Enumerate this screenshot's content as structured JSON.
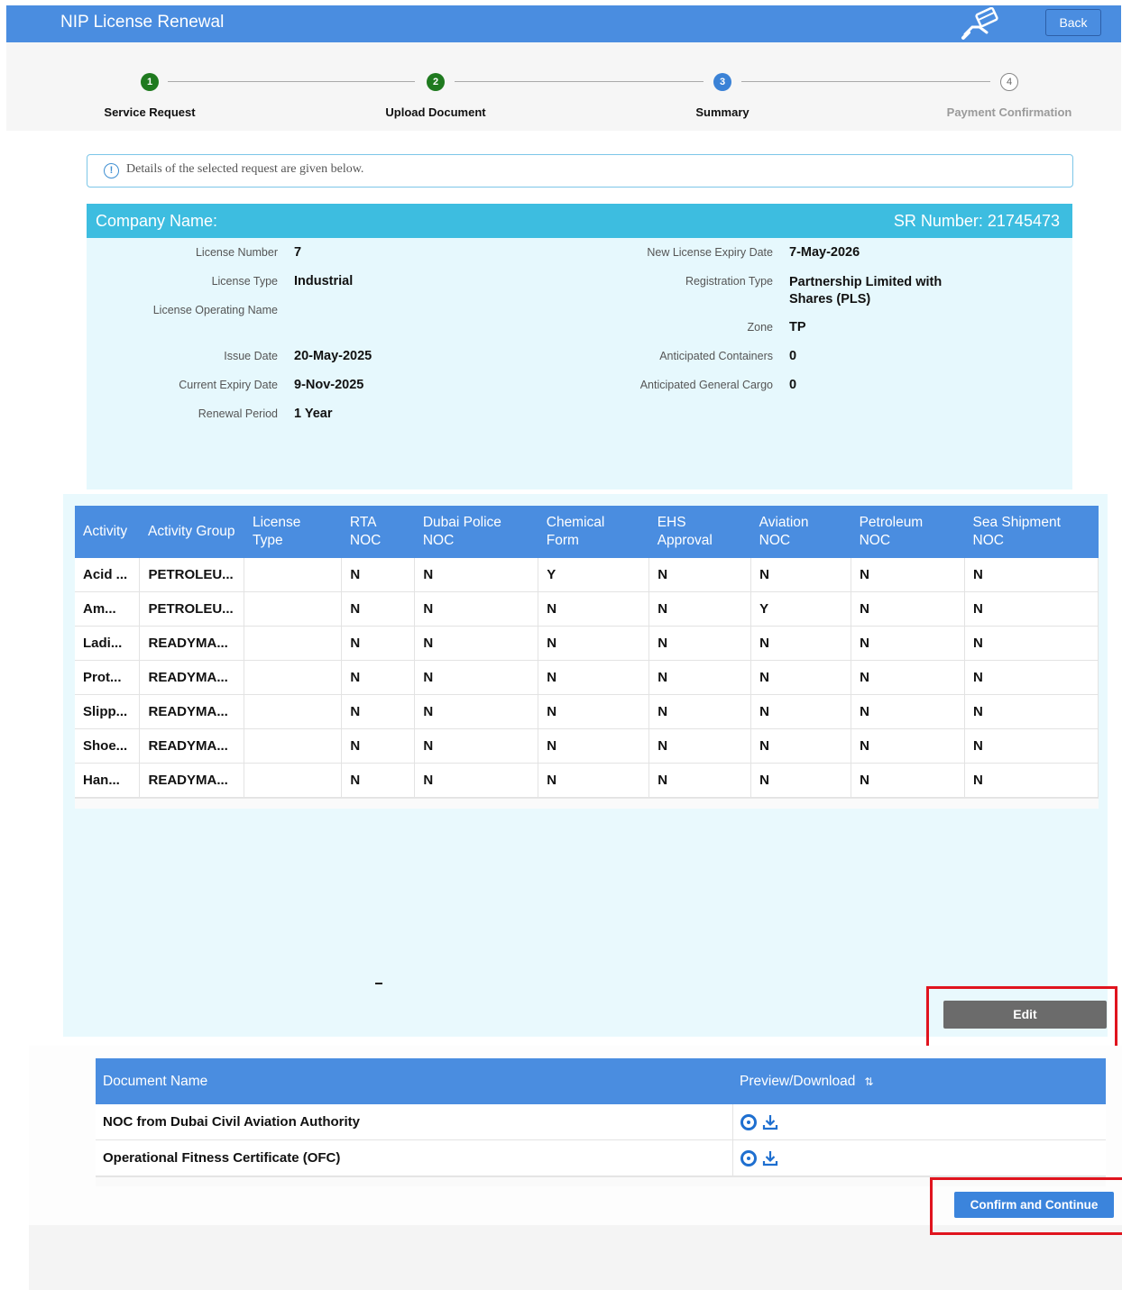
{
  "header": {
    "title": "NIP License Renewal",
    "back_label": "Back",
    "icon": "hand-card-payment-icon"
  },
  "stepper": {
    "steps": [
      {
        "number": "1",
        "label": "Service Request",
        "state": "done"
      },
      {
        "number": "2",
        "label": "Upload Document",
        "state": "done"
      },
      {
        "number": "3",
        "label": "Summary",
        "state": "current"
      },
      {
        "number": "4",
        "label": "Payment Confirmation",
        "state": "todo"
      }
    ]
  },
  "info_banner": {
    "text": "Details of the selected request are given below."
  },
  "company": {
    "name_label": "Company Name:",
    "sr_label": "SR Number: 21745473",
    "left_fields": [
      {
        "label": "License Number",
        "value": "7"
      },
      {
        "label": "License Type",
        "value": "Industrial"
      },
      {
        "label": "License Operating Name",
        "value": ""
      },
      {
        "label": "Issue Date",
        "value": "20-May-2025"
      },
      {
        "label": "Current Expiry Date",
        "value": "9-Nov-2025"
      },
      {
        "label": "Renewal Period",
        "value": "1 Year"
      }
    ],
    "right_fields": [
      {
        "label": "New License Expiry Date",
        "value": "7-May-2026"
      },
      {
        "label": "Registration Type",
        "value": "Partnership Limited with Shares (PLS)"
      },
      {
        "label": "Zone",
        "value": "TP"
      },
      {
        "label": "Anticipated Containers",
        "value": "0"
      },
      {
        "label": "Anticipated General Cargo",
        "value": "0"
      }
    ]
  },
  "activities": {
    "columns": [
      "Activity",
      "Activity Group",
      "License Type",
      "RTA NOC",
      "Dubai Police NOC",
      "Chemical Form",
      "EHS Approval",
      "Aviation NOC",
      "Petroleum NOC",
      "Sea Shipment NOC"
    ],
    "rows": [
      [
        "Acid ...",
        "PETROLEU...",
        "",
        "N",
        "N",
        "Y",
        "N",
        "N",
        "N",
        "N"
      ],
      [
        "Am...",
        "PETROLEU...",
        "",
        "N",
        "N",
        "N",
        "N",
        "Y",
        "N",
        "N"
      ],
      [
        "Ladi...",
        "READYMA...",
        "",
        "N",
        "N",
        "N",
        "N",
        "N",
        "N",
        "N"
      ],
      [
        "Prot...",
        "READYMA...",
        "",
        "N",
        "N",
        "N",
        "N",
        "N",
        "N",
        "N"
      ],
      [
        "Slipp...",
        "READYMA...",
        "",
        "N",
        "N",
        "N",
        "N",
        "N",
        "N",
        "N"
      ],
      [
        "Shoe...",
        "READYMA...",
        "",
        "N",
        "N",
        "N",
        "N",
        "N",
        "N",
        "N"
      ],
      [
        "Han...",
        "READYMA...",
        "",
        "N",
        "N",
        "N",
        "N",
        "N",
        "N",
        "N"
      ]
    ],
    "edit_label": "Edit"
  },
  "documents": {
    "columns": [
      "Document Name",
      "Preview/Download"
    ],
    "sort_icon": "sort-icon",
    "rows": [
      {
        "name": "NOC from Dubai Civil Aviation Authority"
      },
      {
        "name": "Operational Fitness Certificate (OFC)"
      }
    ]
  },
  "confirm_label": "Confirm and Continue",
  "colors": {
    "header": "#4a8de0",
    "panel_head": "#3dbde0",
    "panel_body": "#e6f8fd",
    "highlight": "#e0141e",
    "step_done": "#1f7a1f",
    "step_current": "#3b82d6"
  }
}
